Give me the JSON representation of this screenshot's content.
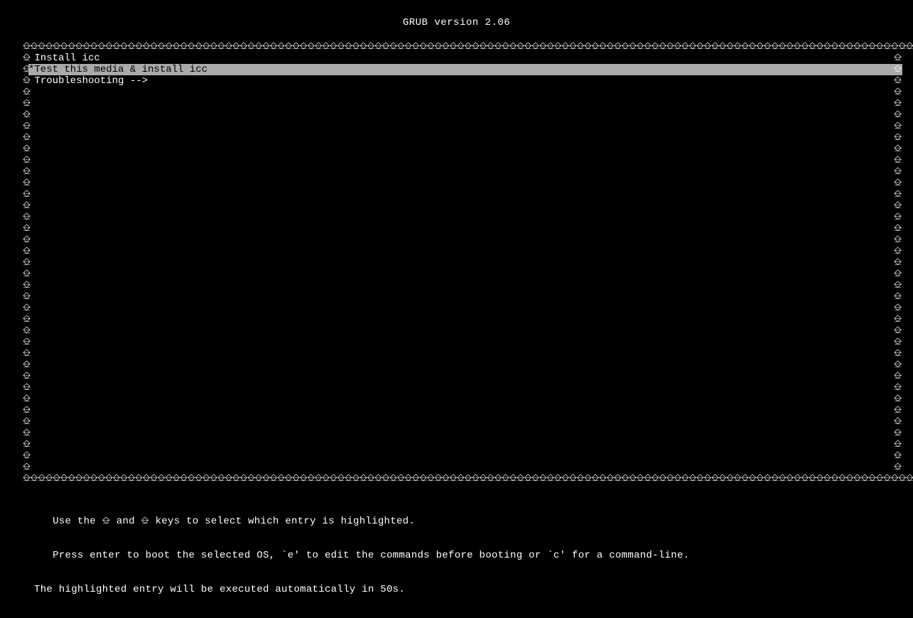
{
  "header": {
    "text": "GRUB version 2.06"
  },
  "menu": {
    "items": [
      {
        "label": " Install icc",
        "selected": false
      },
      {
        "label": "*Test this media & install icc",
        "selected": true
      },
      {
        "label": " Troubleshooting -->",
        "selected": false
      }
    ],
    "empty_rows": 34,
    "border_char": "⎒"
  },
  "footer": {
    "line1": "   Use the ⎒ and ⎒ keys to select which entry is highlighted.",
    "line2": "   Press enter to boot the selected OS, `e' to edit the commands before booting or `c' for a command-line.",
    "line3": "The highlighted entry will be executed automatically in 50s."
  }
}
